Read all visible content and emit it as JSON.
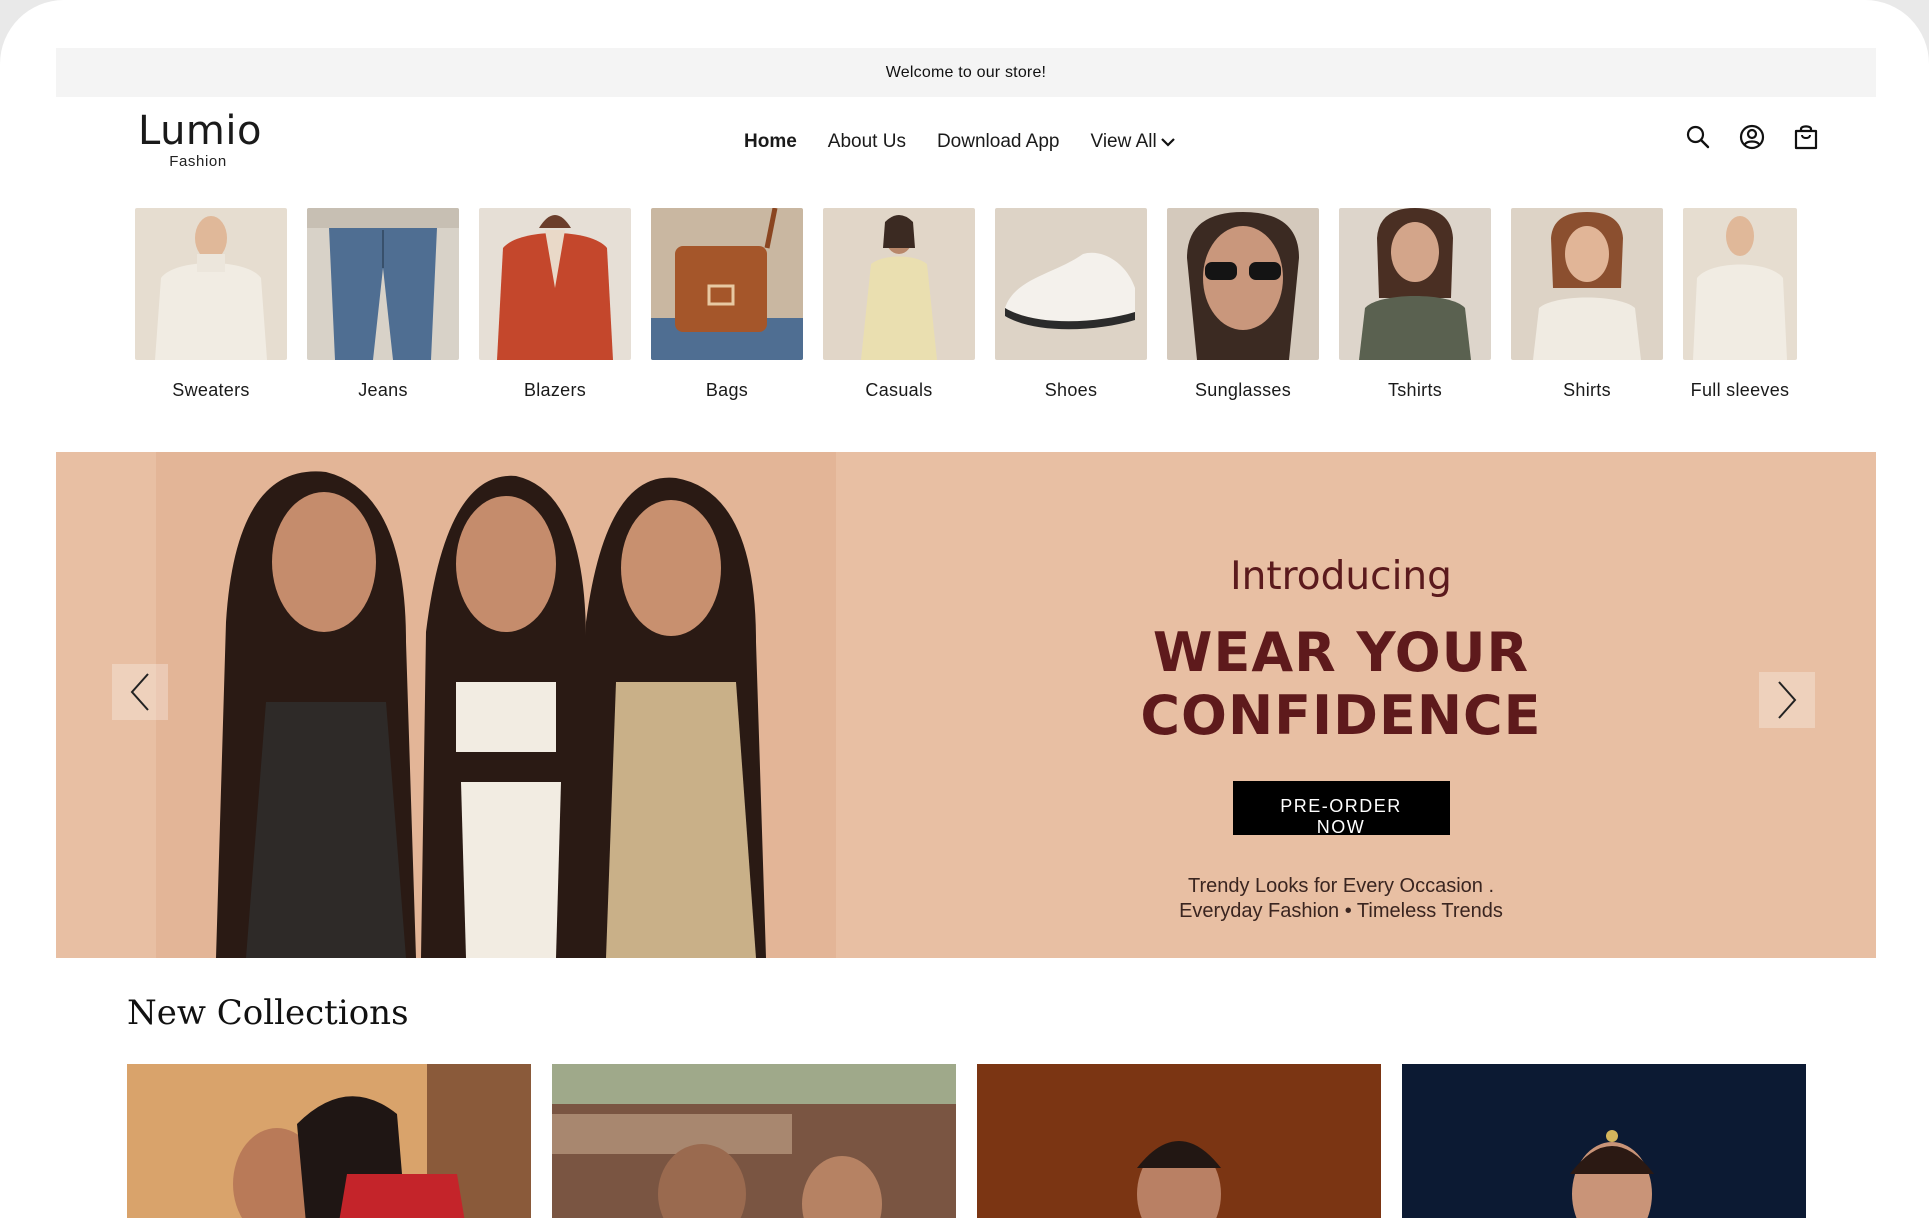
{
  "announcement": "Welcome to our store!",
  "brand": {
    "name": "Lumio",
    "tagline": "Fashion"
  },
  "nav": {
    "items": [
      {
        "label": "Home",
        "active": true
      },
      {
        "label": "About Us"
      },
      {
        "label": "Download App"
      },
      {
        "label": "View All",
        "has_dropdown": true
      }
    ]
  },
  "header_icons": [
    "search-icon",
    "account-icon",
    "cart-bag-icon"
  ],
  "categories": [
    {
      "label": "Sweaters"
    },
    {
      "label": "Jeans"
    },
    {
      "label": "Blazers"
    },
    {
      "label": "Bags"
    },
    {
      "label": "Casuals"
    },
    {
      "label": "Shoes"
    },
    {
      "label": "Sunglasses"
    },
    {
      "label": "Tshirts"
    },
    {
      "label": "Shirts"
    },
    {
      "label": "Full sleeves"
    }
  ],
  "hero": {
    "intro": "Introducing",
    "title": "WEAR YOUR CONFIDENCE",
    "cta": "PRE-ORDER NOW",
    "tagline_line1": "Trendy Looks for Every Occasion .",
    "tagline_line2": "Everyday Fashion • Timeless Trends",
    "background_color": "#e8bfa3",
    "title_color": "#5e1a1c"
  },
  "new_collections": {
    "title": "New Collections"
  },
  "colors": {
    "announcement_bg": "#f4f4f4",
    "button_bg": "#000000",
    "accent": "#5e1a1c"
  }
}
